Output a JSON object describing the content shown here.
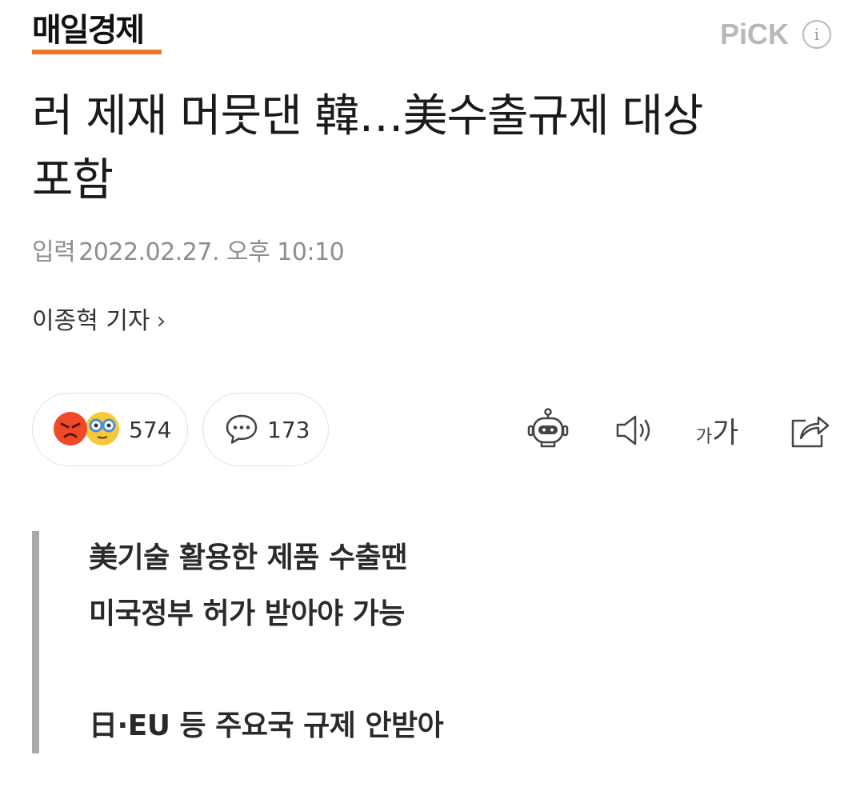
{
  "header": {
    "logo": "매일경제",
    "pick_label": "PiCK",
    "info_label": "i"
  },
  "article": {
    "headline_line1": "러 제재 머뭇댄 韓…美수출규제 대상",
    "headline_line2": "포함",
    "date_label": "입력",
    "date_value": "2022.02.27. 오후 10:10",
    "reporter": "이종혁 기자",
    "reporter_chevron": "›"
  },
  "actions": {
    "reaction_count": "574",
    "comment_count": "173",
    "font_small": "가",
    "font_large": "가"
  },
  "summary": {
    "line1": "美기술 활용한 제품 수출땐",
    "line2": "미국정부 허가 받아야 가능",
    "line3": "日·EU 등 주요국 규제 안받아"
  },
  "colors": {
    "accent_orange": "#f07820",
    "pick_gray": "#b8b8b8",
    "summary_bar": "#a9a9a9"
  },
  "icons": {
    "angry": "angry-emoji-icon",
    "nerd": "glasses-emoji-icon",
    "comment": "speech-bubble-icon",
    "robot": "robot-icon",
    "speaker": "speaker-icon",
    "font": "font-size-icon",
    "share": "share-icon",
    "info": "info-icon"
  }
}
